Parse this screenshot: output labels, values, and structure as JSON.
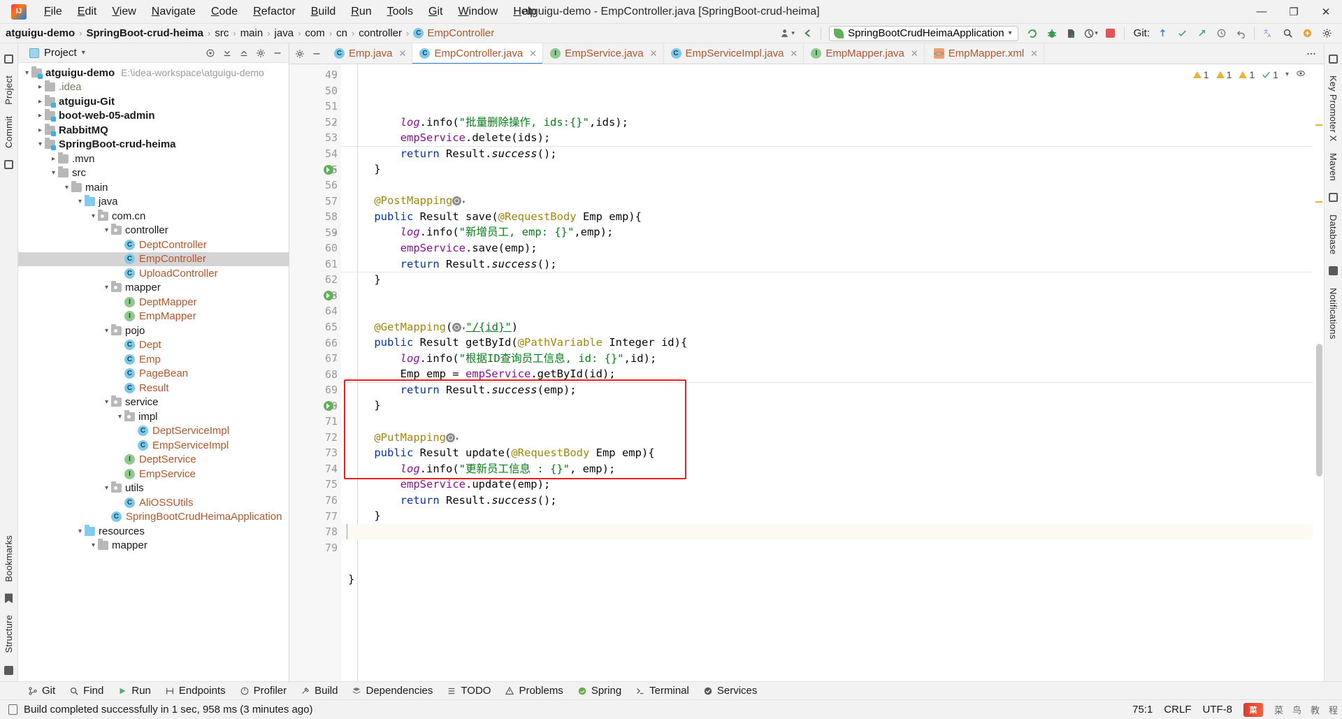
{
  "window": {
    "title": "atguigu-demo - EmpController.java [SpringBoot-crud-heima]",
    "logo_text": "IJ",
    "minimize": "—",
    "maximize": "❐",
    "close": "✕"
  },
  "menu": [
    {
      "label": "File"
    },
    {
      "label": "Edit"
    },
    {
      "label": "View"
    },
    {
      "label": "Navigate"
    },
    {
      "label": "Code"
    },
    {
      "label": "Refactor"
    },
    {
      "label": "Build"
    },
    {
      "label": "Run"
    },
    {
      "label": "Tools"
    },
    {
      "label": "Git"
    },
    {
      "label": "Window"
    },
    {
      "label": "Help"
    }
  ],
  "navbar": {
    "crumbs": [
      {
        "label": "atguigu-demo",
        "bold": true,
        "icon": ""
      },
      {
        "label": "SpringBoot-crud-heima",
        "bold": true,
        "icon": ""
      },
      {
        "label": "src",
        "bold": false,
        "icon": ""
      },
      {
        "label": "main",
        "bold": false,
        "icon": ""
      },
      {
        "label": "java",
        "bold": false,
        "icon": ""
      },
      {
        "label": "com",
        "bold": false,
        "icon": ""
      },
      {
        "label": "cn",
        "bold": false,
        "icon": ""
      },
      {
        "label": "controller",
        "bold": false,
        "icon": ""
      },
      {
        "label": "EmpController",
        "bold": false,
        "icon": "C"
      }
    ],
    "separator": "›",
    "run_config": "SpringBootCrudHeimaApplication",
    "run_config_caret": "▾",
    "git_label": "Git:",
    "icons": {
      "user": "user-icon",
      "back": "back-arrow-icon",
      "rerun": "rerun-icon",
      "debug": "debug-icon",
      "coverage": "coverage-icon",
      "profiler": "profiler-icon",
      "stop": "stop-icon",
      "update_project": "update-project-icon",
      "commit": "commit-icon",
      "push": "push-icon",
      "history": "history-icon",
      "rollback": "rollback-icon",
      "translate": "translate-icon",
      "search": "search-icon",
      "plugin": "plugin-icon",
      "settings": "settings-icon"
    }
  },
  "project_panel": {
    "title": "Project",
    "caret": "▾",
    "header_icons": [
      "target-icon",
      "collapse-all-icon",
      "expand-all-icon",
      "settings-icon",
      "hide-icon"
    ],
    "tree": [
      {
        "depth": 0,
        "arrow": "v",
        "kind": "module",
        "label": "atguigu-demo",
        "bold": true,
        "path": "E:\\idea-workspace\\atguigu-demo"
      },
      {
        "depth": 1,
        "arrow": ">",
        "kind": "folder",
        "label": ".idea",
        "bold": false,
        "grey": true,
        "path": ""
      },
      {
        "depth": 1,
        "arrow": ">",
        "kind": "module",
        "label": "atguigu-Git",
        "bold": true,
        "path": ""
      },
      {
        "depth": 1,
        "arrow": ">",
        "kind": "module",
        "label": "boot-web-05-admin",
        "bold": true,
        "path": ""
      },
      {
        "depth": 1,
        "arrow": ">",
        "kind": "module",
        "label": "RabbitMQ",
        "bold": true,
        "path": ""
      },
      {
        "depth": 1,
        "arrow": "v",
        "kind": "module",
        "label": "SpringBoot-crud-heima",
        "bold": true,
        "path": ""
      },
      {
        "depth": 2,
        "arrow": ">",
        "kind": "folder",
        "label": ".mvn",
        "bold": false,
        "path": ""
      },
      {
        "depth": 2,
        "arrow": "v",
        "kind": "folder",
        "label": "src",
        "bold": false,
        "path": ""
      },
      {
        "depth": 3,
        "arrow": "v",
        "kind": "folder",
        "label": "main",
        "bold": false,
        "path": ""
      },
      {
        "depth": 4,
        "arrow": "v",
        "kind": "source",
        "label": "java",
        "bold": false,
        "path": ""
      },
      {
        "depth": 5,
        "arrow": "v",
        "kind": "package",
        "label": "com.cn",
        "bold": false,
        "path": ""
      },
      {
        "depth": 6,
        "arrow": "v",
        "kind": "package",
        "label": "controller",
        "bold": false,
        "path": ""
      },
      {
        "depth": 7,
        "arrow": "",
        "kind": "class",
        "label": "DeptController",
        "bold": false,
        "path": ""
      },
      {
        "depth": 7,
        "arrow": "",
        "kind": "class",
        "label": "EmpController",
        "bold": false,
        "selected": true,
        "path": ""
      },
      {
        "depth": 7,
        "arrow": "",
        "kind": "class",
        "label": "UploadController",
        "bold": false,
        "path": ""
      },
      {
        "depth": 6,
        "arrow": "v",
        "kind": "package",
        "label": "mapper",
        "bold": false,
        "path": ""
      },
      {
        "depth": 7,
        "arrow": "",
        "kind": "iface",
        "label": "DeptMapper",
        "bold": false,
        "path": ""
      },
      {
        "depth": 7,
        "arrow": "",
        "kind": "iface",
        "label": "EmpMapper",
        "bold": false,
        "path": ""
      },
      {
        "depth": 6,
        "arrow": "v",
        "kind": "package",
        "label": "pojo",
        "bold": false,
        "path": ""
      },
      {
        "depth": 7,
        "arrow": "",
        "kind": "class",
        "label": "Dept",
        "bold": false,
        "path": ""
      },
      {
        "depth": 7,
        "arrow": "",
        "kind": "class",
        "label": "Emp",
        "bold": false,
        "path": ""
      },
      {
        "depth": 7,
        "arrow": "",
        "kind": "class",
        "label": "PageBean",
        "bold": false,
        "path": ""
      },
      {
        "depth": 7,
        "arrow": "",
        "kind": "class",
        "label": "Result",
        "bold": false,
        "path": ""
      },
      {
        "depth": 6,
        "arrow": "v",
        "kind": "package",
        "label": "service",
        "bold": false,
        "path": ""
      },
      {
        "depth": 7,
        "arrow": "v",
        "kind": "package",
        "label": "impl",
        "bold": false,
        "path": ""
      },
      {
        "depth": 8,
        "arrow": "",
        "kind": "class",
        "label": "DeptServiceImpl",
        "bold": false,
        "path": ""
      },
      {
        "depth": 8,
        "arrow": "",
        "kind": "class",
        "label": "EmpServiceImpl",
        "bold": false,
        "path": ""
      },
      {
        "depth": 7,
        "arrow": "",
        "kind": "iface",
        "label": "DeptService",
        "bold": false,
        "path": ""
      },
      {
        "depth": 7,
        "arrow": "",
        "kind": "iface",
        "label": "EmpService",
        "bold": false,
        "path": ""
      },
      {
        "depth": 6,
        "arrow": "v",
        "kind": "package",
        "label": "utils",
        "bold": false,
        "path": ""
      },
      {
        "depth": 7,
        "arrow": "",
        "kind": "class",
        "label": "AliOSSUtils",
        "bold": false,
        "path": ""
      },
      {
        "depth": 6,
        "arrow": "",
        "kind": "class",
        "label": "SpringBootCrudHeimaApplication",
        "bold": false,
        "path": ""
      },
      {
        "depth": 4,
        "arrow": "v",
        "kind": "resource",
        "label": "resources",
        "bold": false,
        "path": ""
      },
      {
        "depth": 5,
        "arrow": "v",
        "kind": "folder",
        "label": "mapper",
        "bold": false,
        "path": ""
      }
    ]
  },
  "left_rail": [
    "Project",
    "Commit"
  ],
  "left_rail_bottom": [
    "Bookmarks",
    "Structure"
  ],
  "right_rail": [
    "Key Promoter X",
    "Maven",
    "Database",
    "Notifications"
  ],
  "editor": {
    "tabs": [
      {
        "label": "Emp.java",
        "icon": "C",
        "icon_kind": "class",
        "active": false
      },
      {
        "label": "EmpController.java",
        "icon": "C",
        "icon_kind": "class",
        "active": true
      },
      {
        "label": "EmpService.java",
        "icon": "I",
        "icon_kind": "iface",
        "active": false
      },
      {
        "label": "EmpServiceImpl.java",
        "icon": "C",
        "icon_kind": "class",
        "active": false
      },
      {
        "label": "EmpMapper.java",
        "icon": "I",
        "icon_kind": "iface",
        "active": false
      },
      {
        "label": "EmpMapper.xml",
        "icon": "<>",
        "icon_kind": "xml",
        "active": false
      }
    ],
    "inspections": [
      {
        "type": "warning",
        "count": "1"
      },
      {
        "type": "warning",
        "count": "1"
      },
      {
        "type": "warning",
        "count": "1"
      },
      {
        "type": "ok",
        "count": "1"
      }
    ],
    "first_line_number": 49,
    "lines": [
      {
        "n": 49,
        "indent": 2,
        "tokens": [
          {
            "t": "log",
            "c": "fld-i"
          },
          {
            "t": ".info(",
            "c": "plain"
          },
          {
            "t": "\"批量删除操作, ids:{}\"",
            "c": "str"
          },
          {
            "t": ",ids);",
            "c": "plain"
          }
        ]
      },
      {
        "n": 50,
        "indent": 2,
        "tokens": [
          {
            "t": "empService",
            "c": "fld"
          },
          {
            "t": ".delete(ids);",
            "c": "plain"
          }
        ]
      },
      {
        "n": 51,
        "indent": 2,
        "tokens": [
          {
            "t": "return ",
            "c": "kw"
          },
          {
            "t": "Result.",
            "c": "plain"
          },
          {
            "t": "success",
            "c": "stat"
          },
          {
            "t": "();",
            "c": "plain"
          }
        ]
      },
      {
        "n": 52,
        "indent": 1,
        "tokens": [
          {
            "t": "}",
            "c": "plain"
          }
        ],
        "fold": "end"
      },
      {
        "n": 53,
        "indent": 0,
        "tokens": []
      },
      {
        "n": 54,
        "indent": 1,
        "tokens": [
          {
            "t": "@PostMapping",
            "c": "ann"
          },
          {
            "t": "GLOBE",
            "c": "globe"
          }
        ],
        "sep_above": true
      },
      {
        "n": 55,
        "indent": 1,
        "tokens": [
          {
            "t": "public ",
            "c": "kw"
          },
          {
            "t": "Result ",
            "c": "plain"
          },
          {
            "t": "save",
            "c": "plain"
          },
          {
            "t": "(",
            "c": "plain"
          },
          {
            "t": "@RequestBody",
            "c": "ann"
          },
          {
            "t": " Emp emp){",
            "c": "plain"
          }
        ],
        "run": true,
        "fold": "start"
      },
      {
        "n": 56,
        "indent": 2,
        "tokens": [
          {
            "t": "log",
            "c": "fld-i"
          },
          {
            "t": ".info(",
            "c": "plain"
          },
          {
            "t": "\"新增员工, emp: {}\"",
            "c": "str"
          },
          {
            "t": ",emp);",
            "c": "plain"
          }
        ]
      },
      {
        "n": 57,
        "indent": 2,
        "tokens": [
          {
            "t": "empService",
            "c": "fld"
          },
          {
            "t": ".save(emp);",
            "c": "plain"
          }
        ]
      },
      {
        "n": 58,
        "indent": 2,
        "tokens": [
          {
            "t": "return ",
            "c": "kw"
          },
          {
            "t": "Result.",
            "c": "plain"
          },
          {
            "t": "success",
            "c": "stat"
          },
          {
            "t": "();",
            "c": "plain"
          }
        ]
      },
      {
        "n": 59,
        "indent": 1,
        "tokens": [
          {
            "t": "}",
            "c": "plain"
          }
        ],
        "fold": "end"
      },
      {
        "n": 60,
        "indent": 0,
        "tokens": []
      },
      {
        "n": 61,
        "indent": 0,
        "tokens": []
      },
      {
        "n": 62,
        "indent": 1,
        "tokens": [
          {
            "t": "@GetMapping",
            "c": "ann"
          },
          {
            "t": "(",
            "c": "plain"
          },
          {
            "t": "GLOBE",
            "c": "globe"
          },
          {
            "t": "\"/{id}\"",
            "c": "str-u"
          },
          {
            "t": ")",
            "c": "plain"
          }
        ],
        "sep_above": true
      },
      {
        "n": 63,
        "indent": 1,
        "tokens": [
          {
            "t": "public ",
            "c": "kw"
          },
          {
            "t": "Result ",
            "c": "plain"
          },
          {
            "t": "getById",
            "c": "plain"
          },
          {
            "t": "(",
            "c": "plain"
          },
          {
            "t": "@PathVariable",
            "c": "ann"
          },
          {
            "t": " Integer id){",
            "c": "plain"
          }
        ],
        "run": true,
        "fold": "start"
      },
      {
        "n": 64,
        "indent": 2,
        "tokens": [
          {
            "t": "log",
            "c": "fld-i"
          },
          {
            "t": ".info(",
            "c": "plain"
          },
          {
            "t": "\"根据ID查询员工信息, id: {}\"",
            "c": "str"
          },
          {
            "t": ",id);",
            "c": "plain"
          }
        ]
      },
      {
        "n": 65,
        "indent": 2,
        "tokens": [
          {
            "t": "Emp emp = ",
            "c": "plain"
          },
          {
            "t": "empService",
            "c": "fld"
          },
          {
            "t": ".getById(id);",
            "c": "plain"
          }
        ]
      },
      {
        "n": 66,
        "indent": 2,
        "tokens": [
          {
            "t": "return ",
            "c": "kw"
          },
          {
            "t": "Result.",
            "c": "plain"
          },
          {
            "t": "success",
            "c": "stat"
          },
          {
            "t": "(emp);",
            "c": "plain"
          }
        ]
      },
      {
        "n": 67,
        "indent": 1,
        "tokens": [
          {
            "t": "}",
            "c": "plain"
          }
        ],
        "fold": "end"
      },
      {
        "n": 68,
        "indent": 0,
        "tokens": []
      },
      {
        "n": 69,
        "indent": 1,
        "tokens": [
          {
            "t": "@PutMapping",
            "c": "ann"
          },
          {
            "t": "GLOBE",
            "c": "globe"
          }
        ],
        "sep_above": true,
        "boxed": true
      },
      {
        "n": 70,
        "indent": 1,
        "tokens": [
          {
            "t": "public ",
            "c": "kw"
          },
          {
            "t": "Result ",
            "c": "plain"
          },
          {
            "t": "update",
            "c": "plain"
          },
          {
            "t": "(",
            "c": "plain"
          },
          {
            "t": "@RequestBody",
            "c": "ann"
          },
          {
            "t": " Emp emp){",
            "c": "plain"
          }
        ],
        "run": true,
        "fold": "start",
        "boxed": true
      },
      {
        "n": 71,
        "indent": 2,
        "tokens": [
          {
            "t": "log",
            "c": "fld-i"
          },
          {
            "t": ".info(",
            "c": "plain"
          },
          {
            "t": "\"更新员工信息 : {}\"",
            "c": "str"
          },
          {
            "t": ", emp);",
            "c": "plain"
          }
        ],
        "boxed": true
      },
      {
        "n": 72,
        "indent": 2,
        "tokens": [
          {
            "t": "empService",
            "c": "fld"
          },
          {
            "t": ".update(emp);",
            "c": "plain"
          }
        ],
        "boxed": true
      },
      {
        "n": 73,
        "indent": 2,
        "tokens": [
          {
            "t": "return ",
            "c": "kw"
          },
          {
            "t": "Result.",
            "c": "plain"
          },
          {
            "t": "success",
            "c": "stat"
          },
          {
            "t": "();",
            "c": "plain"
          }
        ],
        "boxed": true
      },
      {
        "n": 74,
        "indent": 1,
        "tokens": [
          {
            "t": "}",
            "c": "plain"
          }
        ],
        "fold": "end",
        "boxed": true
      },
      {
        "n": 75,
        "indent": 0,
        "tokens": [],
        "caret": true,
        "current": true
      },
      {
        "n": 76,
        "indent": 0,
        "tokens": []
      },
      {
        "n": 77,
        "indent": 0,
        "tokens": []
      },
      {
        "n": 78,
        "indent": 0,
        "tokens": [
          {
            "t": "}",
            "c": "plain"
          }
        ]
      },
      {
        "n": 79,
        "indent": 0,
        "tokens": []
      }
    ]
  },
  "tool_windows": [
    {
      "label": "Git",
      "icon": "git-icon"
    },
    {
      "label": "Find",
      "icon": "search-icon"
    },
    {
      "label": "Run",
      "icon": "run-icon"
    },
    {
      "label": "Endpoints",
      "icon": "endpoints-icon"
    },
    {
      "label": "Profiler",
      "icon": "profiler-icon"
    },
    {
      "label": "Build",
      "icon": "build-icon"
    },
    {
      "label": "Dependencies",
      "icon": "dependencies-icon"
    },
    {
      "label": "TODO",
      "icon": "todo-icon"
    },
    {
      "label": "Problems",
      "icon": "problems-icon"
    },
    {
      "label": "Spring",
      "icon": "spring-icon"
    },
    {
      "label": "Terminal",
      "icon": "terminal-icon"
    },
    {
      "label": "Services",
      "icon": "services-icon"
    }
  ],
  "status_bar": {
    "message": "Build completed successfully in 1 sec, 958 ms (3 minutes ago)",
    "caret_position": "75:1",
    "line_separator": "CRLF",
    "encoding": "UTF-8",
    "watermark_badge": "菜",
    "watermark_text": "菜　鸟　教　程"
  },
  "colors": {
    "accent_blue": "#3b87d9",
    "annotation": "#9e880d",
    "string_green": "#067d17",
    "keyword_blue": "#0033b3",
    "field_purple": "#871094",
    "highlight_red": "#f01e1e",
    "selection_grey": "#d4d4d4"
  }
}
